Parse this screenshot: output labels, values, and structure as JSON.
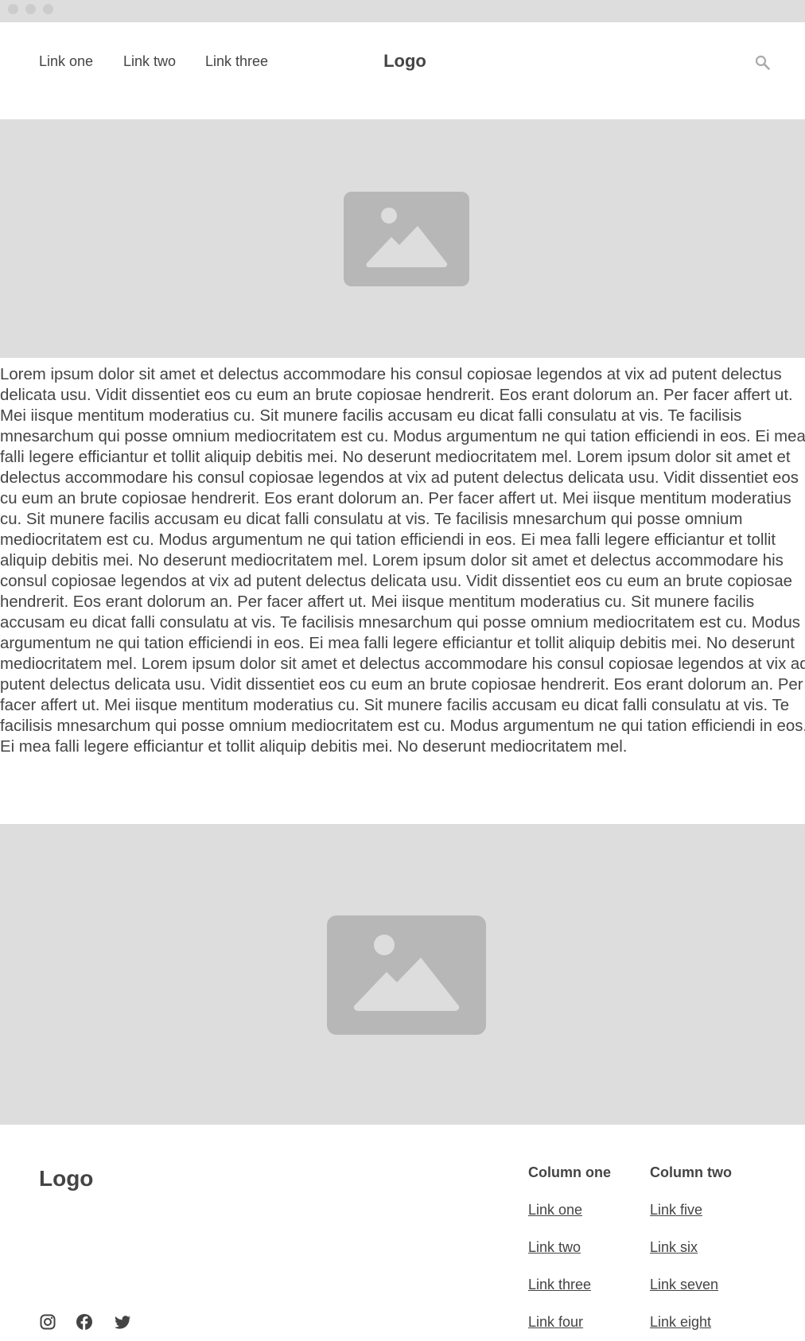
{
  "nav": {
    "links": [
      "Link one",
      "Link two",
      "Link three"
    ],
    "logo": "Logo"
  },
  "icons": {
    "search": "search-icon",
    "hero_image": "image-placeholder-icon",
    "social": [
      "instagram-icon",
      "facebook-icon",
      "twitter-icon"
    ]
  },
  "article": {
    "body": "Lorem ipsum dolor sit amet et delectus accommodare his consul copiosae legendos at vix ad putent delectus delicata usu. Vidit dissentiet eos cu eum an brute copiosae hendrerit. Eos erant dolorum an. Per facer affert ut. Mei iisque mentitum moderatius cu. Sit munere facilis accusam eu dicat falli consulatu at vis. Te facilisis mnesarchum qui posse omnium mediocritatem est cu. Modus argumentum ne qui tation efficiendi in eos. Ei mea falli legere efficiantur et tollit aliquip debitis mei. No deserunt mediocritatem mel. Lorem ipsum dolor sit amet et delectus accommodare his consul copiosae legendos at vix ad putent delectus delicata usu. Vidit dissentiet eos cu eum an brute copiosae hendrerit. Eos erant dolorum an. Per facer affert ut. Mei iisque mentitum moderatius cu. Sit munere facilis accusam eu dicat falli consulatu at vis. Te facilisis mnesarchum qui posse omnium mediocritatem est cu. Modus argumentum ne qui tation efficiendi in eos. Ei mea falli legere efficiantur et tollit aliquip debitis mei. No deserunt mediocritatem mel. Lorem ipsum dolor sit amet et delectus accommodare his consul copiosae legendos at vix ad putent delectus delicata usu. Vidit dissentiet eos cu eum an brute copiosae hendrerit. Eos erant dolorum an. Per facer affert ut. Mei iisque mentitum moderatius cu. Sit munere facilis accusam eu dicat falli consulatu at vis. Te facilisis mnesarchum qui posse omnium mediocritatem est cu. Modus argumentum ne qui tation efficiendi in eos. Ei mea falli legere efficiantur et tollit aliquip debitis mei. No deserunt mediocritatem mel. Lorem ipsum dolor sit amet et delectus accommodare his consul copiosae legendos at vix ad putent delectus delicata usu. Vidit dissentiet eos cu eum an brute copiosae hendrerit. Eos erant dolorum an. Per facer affert ut. Mei iisque mentitum moderatius cu. Sit munere facilis accusam eu dicat falli consulatu at vis. Te facilisis mnesarchum qui posse omnium mediocritatem est cu. Modus argumentum ne qui tation efficiendi in eos. Ei mea falli legere efficiantur et tollit aliquip debitis mei. No deserunt mediocritatem mel."
  },
  "footer": {
    "logo": "Logo",
    "columns": [
      {
        "heading": "Column one",
        "links": [
          "Link one",
          "Link two",
          "Link three",
          "Link four"
        ]
      },
      {
        "heading": "Column two",
        "links": [
          "Link five",
          "Link six",
          "Link seven",
          "Link eight"
        ]
      }
    ]
  },
  "colors": {
    "placeholder_bg": "#dddddd",
    "placeholder_icon": "#b7b7b7",
    "text": "#444444"
  }
}
